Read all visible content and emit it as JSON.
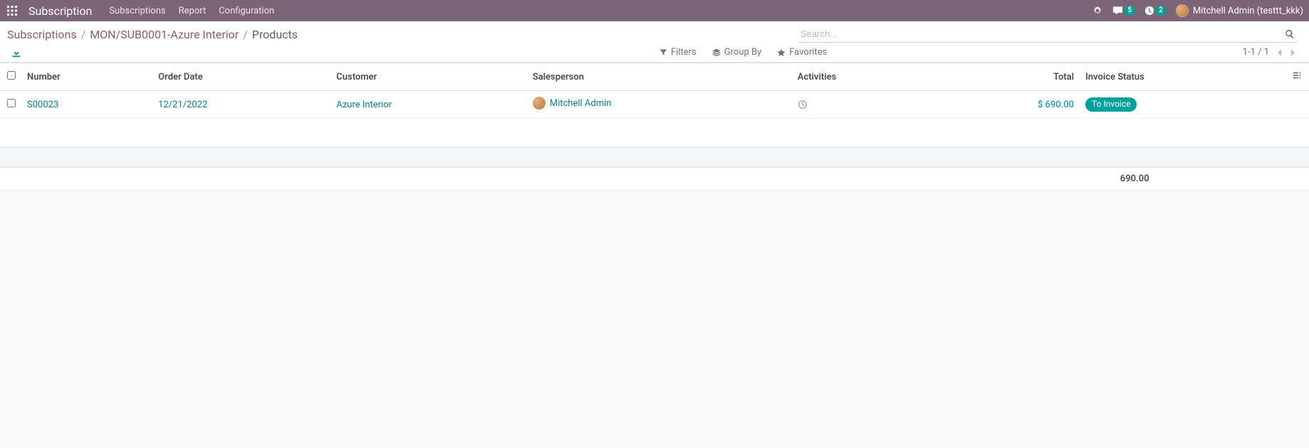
{
  "navbar": {
    "app_title": "Subscription",
    "menu": [
      "Subscriptions",
      "Report",
      "Configuration"
    ],
    "messages_count": "5",
    "activities_count": "2",
    "user_name": "Mitchell Admin (testtt_kkk)"
  },
  "breadcrumb": {
    "items": [
      {
        "label": "Subscriptions",
        "link": true
      },
      {
        "label": "MON/SUB0001-Azure Interior",
        "link": true
      },
      {
        "label": "Products",
        "link": false
      }
    ]
  },
  "search": {
    "placeholder": "Search..."
  },
  "filters": {
    "filters_label": "Filters",
    "groupby_label": "Group By",
    "favorites_label": "Favorites"
  },
  "pager": {
    "text": "1-1 / 1"
  },
  "table": {
    "headers": {
      "number": "Number",
      "order_date": "Order Date",
      "customer": "Customer",
      "salesperson": "Salesperson",
      "activities": "Activities",
      "total": "Total",
      "invoice_status": "Invoice Status"
    },
    "rows": [
      {
        "number": "S00023",
        "order_date": "12/21/2022",
        "customer": "Azure Interior",
        "salesperson": "Mitchell Admin",
        "total": "$ 690.00",
        "invoice_status": "To Invoice"
      }
    ],
    "footer_total": "690.00"
  }
}
